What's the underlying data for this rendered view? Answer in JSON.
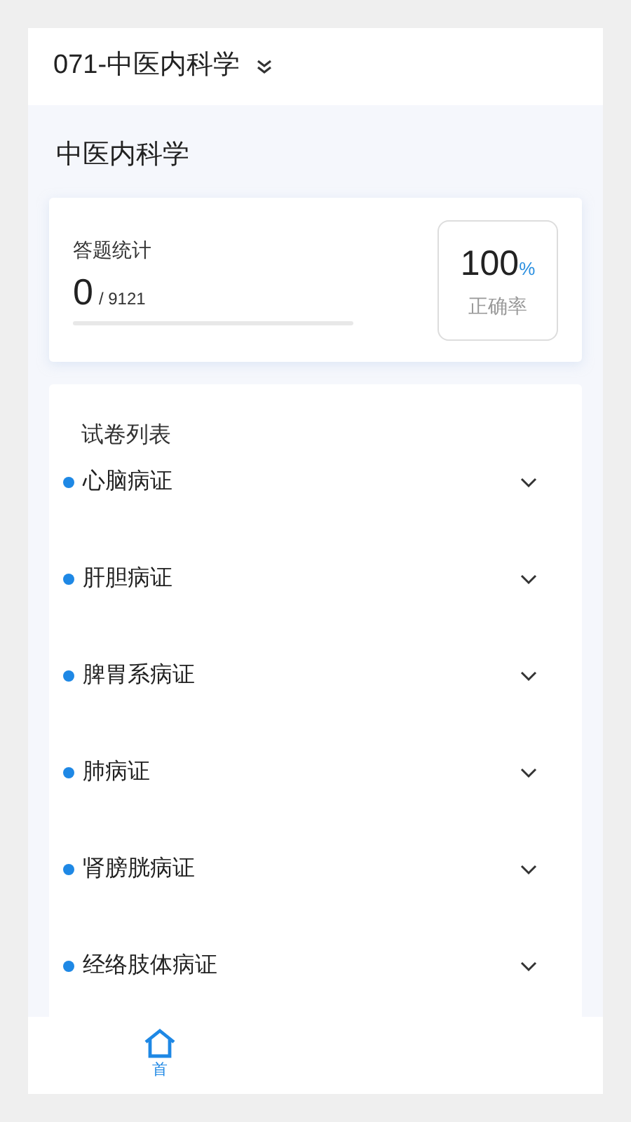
{
  "header": {
    "title": "071-中医内科学",
    "expanded": false
  },
  "subject": "中医内科学",
  "stats": {
    "label": "答题统计",
    "answered": "0",
    "total": "/ 9121",
    "level": 0,
    "rate": "100",
    "rate_unit": "%",
    "rate_label": "正确率"
  },
  "paper_list": {
    "title": "试卷列表",
    "items": [
      {
        "label": "心脑病证",
        "expanded": false
      },
      {
        "label": "肝胆病证",
        "expanded": false
      },
      {
        "label": "脾胃系病证",
        "expanded": false
      },
      {
        "label": "肺病证",
        "expanded": false
      },
      {
        "label": "肾膀胱病证",
        "expanded": false
      },
      {
        "label": "经络肢体病证",
        "expanded": false
      }
    ]
  },
  "nav": [
    {
      "label": "首",
      "selected": true
    }
  ]
}
